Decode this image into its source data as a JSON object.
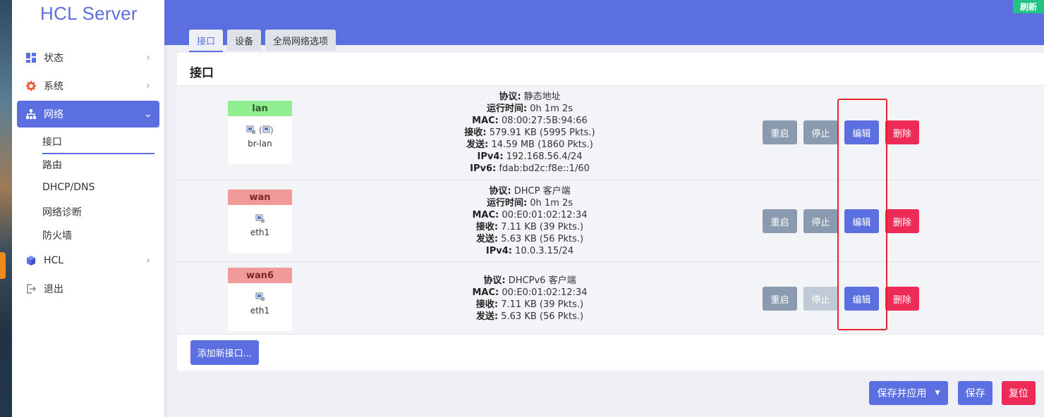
{
  "app": {
    "brand": "HCL Server",
    "refresh_label": "刷新"
  },
  "sidebar": {
    "items": [
      {
        "label": "状态",
        "icon": "dashboard-icon"
      },
      {
        "label": "系统",
        "icon": "gear-icon"
      },
      {
        "label": "网络",
        "icon": "network-tree-icon"
      },
      {
        "label": "HCL",
        "icon": "cube-icon"
      },
      {
        "label": "退出",
        "icon": "logout-icon"
      }
    ],
    "network_subitems": [
      "接口",
      "路由",
      "DHCP/DNS",
      "网络诊断",
      "防火墙"
    ]
  },
  "tabs": [
    "接口",
    "设备",
    "全局网络选项"
  ],
  "section_title": "接口",
  "interfaces": [
    {
      "name": "lan",
      "name_color": "#90ee90",
      "device": "br-lan",
      "lines": [
        {
          "k": "协议:",
          "v": "静态地址"
        },
        {
          "k": "运行时间:",
          "v": "0h 1m 2s"
        },
        {
          "k": "MAC:",
          "v": "08:00:27:5B:94:66"
        },
        {
          "k": "接收:",
          "v": "579.91 KB (5995 Pkts.)"
        },
        {
          "k": "发送:",
          "v": "14.59 MB (1860 Pkts.)"
        },
        {
          "k": "IPv4:",
          "v": "192.168.56.4/24"
        },
        {
          "k": "IPv6:",
          "v": "fdab:bd2c:f8e::1/60"
        }
      ]
    },
    {
      "name": "wan",
      "name_color": "#f09a9a",
      "device": "eth1",
      "lines": [
        {
          "k": "协议:",
          "v": "DHCP 客户端"
        },
        {
          "k": "运行时间:",
          "v": "0h 1m 2s"
        },
        {
          "k": "MAC:",
          "v": "00:E0:01:02:12:34"
        },
        {
          "k": "接收:",
          "v": "7.11 KB (39 Pkts.)"
        },
        {
          "k": "发送:",
          "v": "5.63 KB (56 Pkts.)"
        },
        {
          "k": "IPv4:",
          "v": "10.0.3.15/24"
        }
      ]
    },
    {
      "name": "wan6",
      "name_color": "#f09a9a",
      "device": "eth1",
      "lines": [
        {
          "k": "协议:",
          "v": "DHCPv6 客户端"
        },
        {
          "k": "MAC:",
          "v": "00:E0:01:02:12:34"
        },
        {
          "k": "接收:",
          "v": "7.11 KB (39 Pkts.)"
        },
        {
          "k": "发送:",
          "v": "5.63 KB (56 Pkts.)"
        }
      ]
    }
  ],
  "row_buttons": {
    "restart": "重启",
    "stop": "停止",
    "edit": "编辑",
    "delete": "删除"
  },
  "add_interface_label": "添加新接口...",
  "footer": {
    "save_apply": "保存并应用",
    "save": "保存",
    "reset": "复位"
  }
}
